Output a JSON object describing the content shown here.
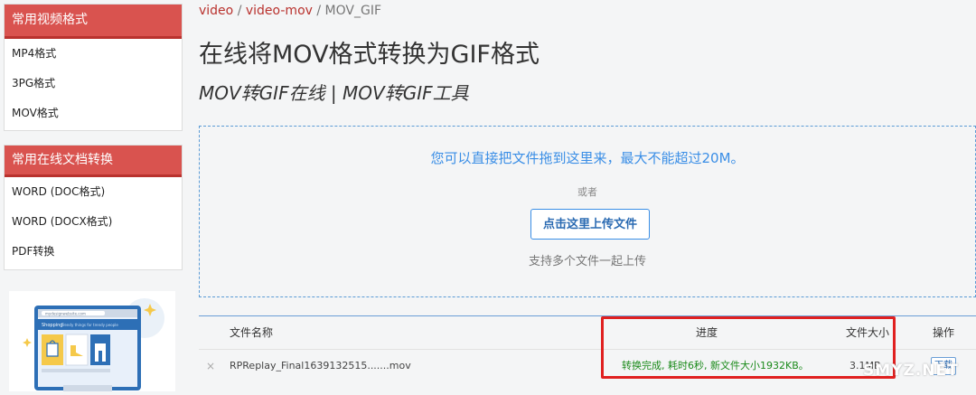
{
  "sidebar": {
    "section1": {
      "title": "常用视频格式",
      "items": [
        "MP4格式",
        "3PG格式",
        "MOV格式"
      ]
    },
    "section2": {
      "title": "常用在线文档转换",
      "items": [
        "WORD (DOC格式)",
        "WORD (DOCX格式)",
        "PDF转换"
      ]
    },
    "promo": {
      "url": "mydesignwebsite.com",
      "heading": "Shopping",
      "tagline": "Trendy things for trendy people"
    }
  },
  "breadcrumb": {
    "link1": "video",
    "sep1": " / ",
    "link2": "video-mov",
    "sep2": " / ",
    "current": "MOV_GIF"
  },
  "page": {
    "title": "在线将MOV格式转换为GIF格式",
    "subtitle": "MOV转GIF在线 | MOV转GIF工具"
  },
  "dropzone": {
    "hint": "您可以直接把文件拖到这里来，最大不能超过20M。",
    "or": "或者",
    "button": "点击这里上传文件",
    "multi": "支持多个文件一起上传"
  },
  "table": {
    "headers": {
      "filename": "文件名称",
      "progress": "进度",
      "size": "文件大小",
      "action": "操作"
    },
    "rows": [
      {
        "remove": "×",
        "filename": "RPReplay_Final1639132515.......mov",
        "progress": "转换完成, 耗时6秒, 新文件大小1932KB。",
        "size": "3.1MB",
        "action": "下载"
      }
    ]
  },
  "watermark": "SMYZ.NET",
  "colors": {
    "accent_red": "#d9534f",
    "link_blue": "#3a8ee6",
    "success_green": "#1a8a1a",
    "annotation_red": "#e02020"
  }
}
